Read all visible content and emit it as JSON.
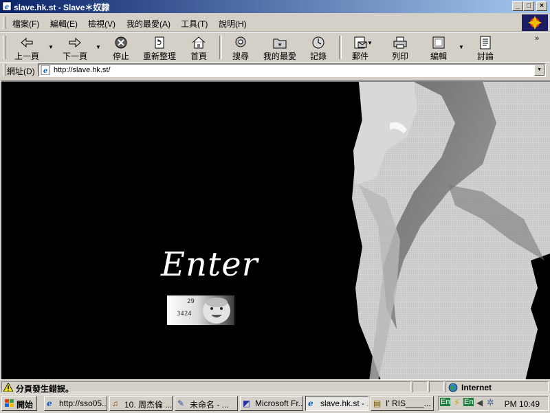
{
  "window": {
    "title": "slave.hk.st - Slave＊奴隷"
  },
  "menu": {
    "items": [
      "檔案(F)",
      "編輯(E)",
      "檢視(V)",
      "我的最愛(A)",
      "工具(T)",
      "說明(H)"
    ]
  },
  "toolbar": {
    "back": "上一頁",
    "forward": "下一頁",
    "stop": "停止",
    "refresh": "重新整理",
    "home": "首頁",
    "search": "搜尋",
    "favorites": "我的最愛",
    "history": "記錄",
    "mail": "郵件",
    "print": "列印",
    "edit": "編輯",
    "discuss": "討論"
  },
  "address": {
    "label": "網址(D)",
    "url": "http://slave.hk.st/"
  },
  "page": {
    "enter_label": "Enter",
    "counter_top": "29",
    "counter_bottom": "3424"
  },
  "status": {
    "message": "分頁發生錯誤。",
    "zone": "Internet"
  },
  "taskbar": {
    "start": "開始",
    "tasks": [
      {
        "label": "http://sso05...."
      },
      {
        "label": "10. 周杰倫 ..."
      },
      {
        "label": "未命名 - ..."
      },
      {
        "label": "Microsoft Fr..."
      },
      {
        "label": "slave.hk.st - ..."
      },
      {
        "label": "I' RIS____..."
      }
    ],
    "clock": "PM 10:49",
    "tray_lang": "En"
  }
}
